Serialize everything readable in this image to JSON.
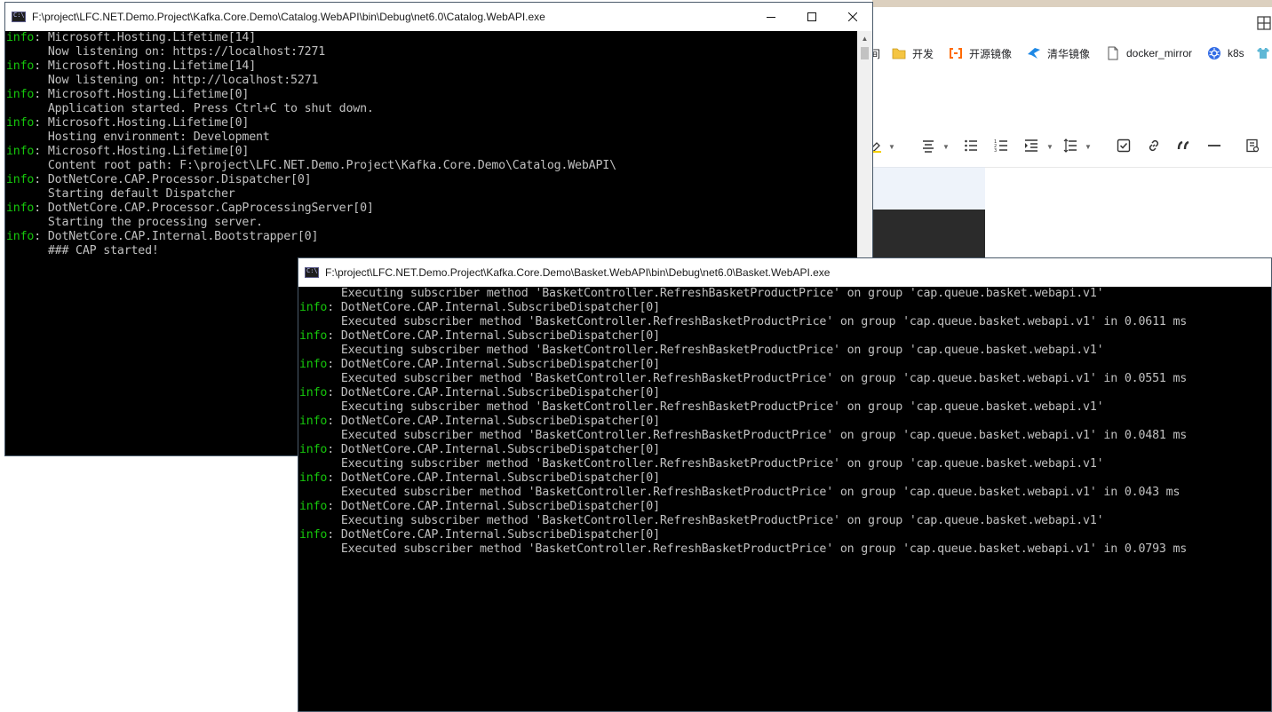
{
  "browser": {
    "bookmarks": [
      {
        "label": "间",
        "icon": "truncated-icon"
      },
      {
        "label": "开发",
        "icon": "folder-icon"
      },
      {
        "label": "开源镜像",
        "icon": "aliyun-icon"
      },
      {
        "label": "清华镜像",
        "icon": "tsinghua-icon"
      },
      {
        "label": "docker_mirror",
        "icon": "page-icon"
      },
      {
        "label": "k8s",
        "icon": "kubernetes-icon"
      }
    ],
    "toolbar_icons": [
      "highlight-icon",
      "align-icon",
      "bullet-list-icon",
      "ordered-list-icon",
      "indent-icon",
      "line-height-icon",
      "task-list-icon",
      "link-icon",
      "quote-icon",
      "horizontal-rule-icon",
      "more-icon"
    ]
  },
  "window1": {
    "title": "F:\\project\\LFC.NET.Demo.Project\\Kafka.Core.Demo\\Catalog.WebAPI\\bin\\Debug\\net6.0\\Catalog.WebAPI.exe",
    "lines": [
      {
        "level": "info",
        "text": ": Microsoft.Hosting.Lifetime[14]"
      },
      {
        "level": "",
        "text": "      Now listening on: https://localhost:7271"
      },
      {
        "level": "info",
        "text": ": Microsoft.Hosting.Lifetime[14]"
      },
      {
        "level": "",
        "text": "      Now listening on: http://localhost:5271"
      },
      {
        "level": "info",
        "text": ": Microsoft.Hosting.Lifetime[0]"
      },
      {
        "level": "",
        "text": "      Application started. Press Ctrl+C to shut down."
      },
      {
        "level": "info",
        "text": ": Microsoft.Hosting.Lifetime[0]"
      },
      {
        "level": "",
        "text": "      Hosting environment: Development"
      },
      {
        "level": "info",
        "text": ": Microsoft.Hosting.Lifetime[0]"
      },
      {
        "level": "",
        "text": "      Content root path: F:\\project\\LFC.NET.Demo.Project\\Kafka.Core.Demo\\Catalog.WebAPI\\"
      },
      {
        "level": "info",
        "text": ": DotNetCore.CAP.Processor.Dispatcher[0]"
      },
      {
        "level": "",
        "text": "      Starting default Dispatcher"
      },
      {
        "level": "info",
        "text": ": DotNetCore.CAP.Processor.CapProcessingServer[0]"
      },
      {
        "level": "",
        "text": "      Starting the processing server."
      },
      {
        "level": "info",
        "text": ": DotNetCore.CAP.Internal.Bootstrapper[0]"
      },
      {
        "level": "",
        "text": "      ### CAP started!"
      }
    ]
  },
  "window2": {
    "title": "F:\\project\\LFC.NET.Demo.Project\\Kafka.Core.Demo\\Basket.WebAPI\\bin\\Debug\\net6.0\\Basket.WebAPI.exe",
    "lines": [
      {
        "level": "",
        "text": "      Executing subscriber method 'BasketController.RefreshBasketProductPrice' on group 'cap.queue.basket.webapi.v1'"
      },
      {
        "level": "info",
        "text": ": DotNetCore.CAP.Internal.SubscribeDispatcher[0]"
      },
      {
        "level": "",
        "text": "      Executed subscriber method 'BasketController.RefreshBasketProductPrice' on group 'cap.queue.basket.webapi.v1' in 0.0611 ms"
      },
      {
        "level": "info",
        "text": ": DotNetCore.CAP.Internal.SubscribeDispatcher[0]"
      },
      {
        "level": "",
        "text": "      Executing subscriber method 'BasketController.RefreshBasketProductPrice' on group 'cap.queue.basket.webapi.v1'"
      },
      {
        "level": "info",
        "text": ": DotNetCore.CAP.Internal.SubscribeDispatcher[0]"
      },
      {
        "level": "",
        "text": "      Executed subscriber method 'BasketController.RefreshBasketProductPrice' on group 'cap.queue.basket.webapi.v1' in 0.0551 ms"
      },
      {
        "level": "info",
        "text": ": DotNetCore.CAP.Internal.SubscribeDispatcher[0]"
      },
      {
        "level": "",
        "text": "      Executing subscriber method 'BasketController.RefreshBasketProductPrice' on group 'cap.queue.basket.webapi.v1'"
      },
      {
        "level": "info",
        "text": ": DotNetCore.CAP.Internal.SubscribeDispatcher[0]"
      },
      {
        "level": "",
        "text": "      Executed subscriber method 'BasketController.RefreshBasketProductPrice' on group 'cap.queue.basket.webapi.v1' in 0.0481 ms"
      },
      {
        "level": "info",
        "text": ": DotNetCore.CAP.Internal.SubscribeDispatcher[0]"
      },
      {
        "level": "",
        "text": "      Executing subscriber method 'BasketController.RefreshBasketProductPrice' on group 'cap.queue.basket.webapi.v1'"
      },
      {
        "level": "info",
        "text": ": DotNetCore.CAP.Internal.SubscribeDispatcher[0]"
      },
      {
        "level": "",
        "text": "      Executed subscriber method 'BasketController.RefreshBasketProductPrice' on group 'cap.queue.basket.webapi.v1' in 0.043 ms"
      },
      {
        "level": "info",
        "text": ": DotNetCore.CAP.Internal.SubscribeDispatcher[0]"
      },
      {
        "level": "",
        "text": "      Executing subscriber method 'BasketController.RefreshBasketProductPrice' on group 'cap.queue.basket.webapi.v1'"
      },
      {
        "level": "info",
        "text": ": DotNetCore.CAP.Internal.SubscribeDispatcher[0]"
      },
      {
        "level": "",
        "text": "      Executed subscriber method 'BasketController.RefreshBasketProductPrice' on group 'cap.queue.basket.webapi.v1' in 0.0793 ms"
      }
    ]
  },
  "colors": {
    "console_bg": "#000000",
    "console_text": "#c0c0c0",
    "info_level": "#16c60c"
  }
}
